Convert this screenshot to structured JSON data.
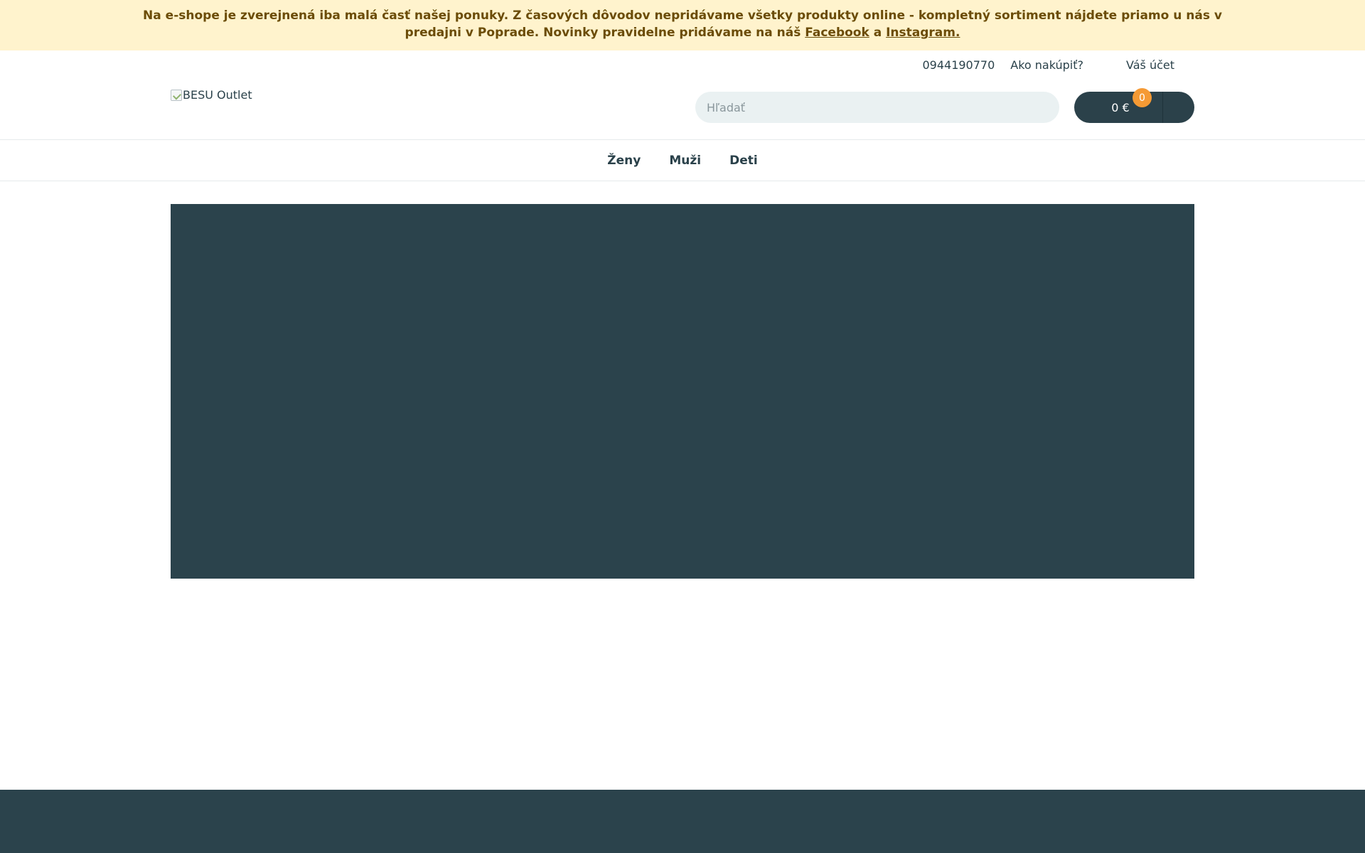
{
  "notice": {
    "line1": "Na e-shope je zverejnená iba malá časť našej ponuky. Z časových dôvodov nepridávame všetky produkty online - kompletný sortiment nájdete priamo u nás v",
    "line2_prefix": "predajni v Poprade. Novinky pravidelne pridávame na náš",
    "facebook": "Facebook",
    "and": "a",
    "instagram": "Instagram."
  },
  "top_links": {
    "phone": "0944190770",
    "how_to_buy": "Ako nakúpiť?",
    "account": "Váš účet"
  },
  "logo": {
    "alt": "BESU Outlet"
  },
  "search": {
    "placeholder": "Hľadať"
  },
  "cart": {
    "total": "0 €",
    "count": "0"
  },
  "nav": {
    "items": [
      {
        "label": "Ženy"
      },
      {
        "label": "Muži"
      },
      {
        "label": "Deti"
      }
    ]
  },
  "colors": {
    "notice_bg": "#fff3cd",
    "notice_text": "#6b4c07",
    "primary_dark": "#2b434c",
    "badge": "#f59a34",
    "search_bg": "#eaf1f2"
  }
}
